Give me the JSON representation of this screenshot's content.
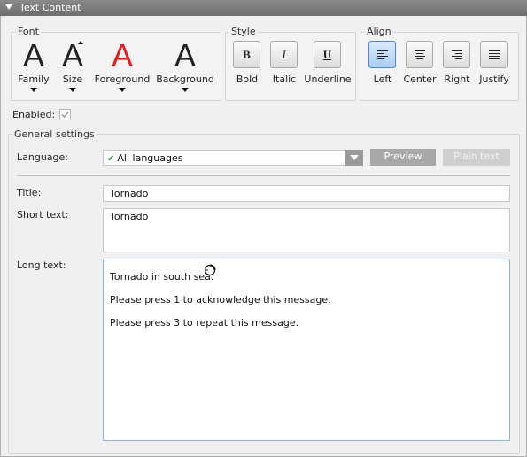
{
  "panel": {
    "title": "Text Content"
  },
  "font_group": {
    "title": "Font",
    "items": [
      {
        "glyph": "A",
        "label": "Family"
      },
      {
        "glyph": "A",
        "label": "Size"
      },
      {
        "glyph": "A",
        "label": "Foreground"
      },
      {
        "glyph": "A",
        "label": "Background"
      }
    ],
    "foreground_color": "#e02020"
  },
  "style_group": {
    "title": "Style",
    "buttons": [
      {
        "glyph": "B",
        "label": "Bold"
      },
      {
        "glyph": "I",
        "label": "Italic"
      },
      {
        "glyph": "U",
        "label": "Underline"
      }
    ]
  },
  "align_group": {
    "title": "Align",
    "buttons": [
      {
        "label": "Left",
        "active": true
      },
      {
        "label": "Center",
        "active": false
      },
      {
        "label": "Right",
        "active": false
      },
      {
        "label": "Justify",
        "active": false
      }
    ]
  },
  "enabled": {
    "label": "Enabled:",
    "checked": true
  },
  "general": {
    "title": "General settings",
    "language_label": "Language:",
    "language_value": "All languages",
    "preview_label": "Preview",
    "plain_text_label": "Plain text",
    "title_label": "Title:",
    "title_value": "Tornado",
    "short_label": "Short text:",
    "short_value": "Tornado",
    "long_label": "Long text:",
    "long_lines": [
      "Tornado in south sea.",
      "Please press 1 to acknowledge this message.",
      "Please press 3 to repeat this message."
    ]
  },
  "colors": {
    "accent": "#4a8ad8",
    "active_button": "#a9cdf3",
    "check_green": "#2e8b2e"
  }
}
